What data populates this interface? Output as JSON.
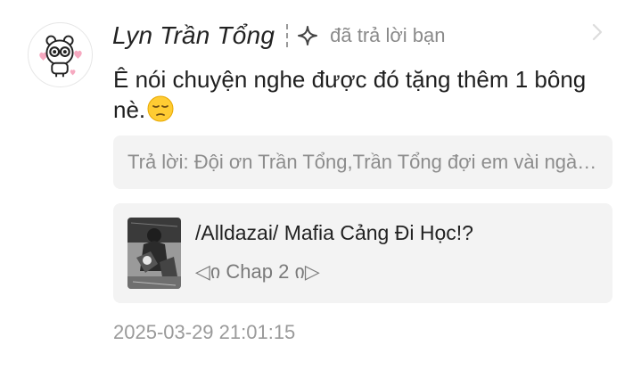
{
  "comment": {
    "username": "Lyn Trần Tổng",
    "action_text": "đã trả lời bạn",
    "message": "Ê nói chuyện nghe được đó tặng thêm 1 bông nè.",
    "reply_preview": "Trả lời: Đội ơn Trần Tổng,Trần Tổng đợi em vài ngày nha",
    "timestamp": "2025-03-29 21:01:15",
    "emoji": "pensive-face"
  },
  "story": {
    "title": "/Alldazai/ Mafia Cảng Đi Học!?",
    "chapter": "◁ი Chap 2 ი▷"
  },
  "icons": {
    "action": "sparkle-icon",
    "navigate": "chevron-right-icon"
  },
  "colors": {
    "text_primary": "#1f1f1f",
    "text_secondary": "#8a8a8a",
    "card_background": "#f3f3f3"
  }
}
